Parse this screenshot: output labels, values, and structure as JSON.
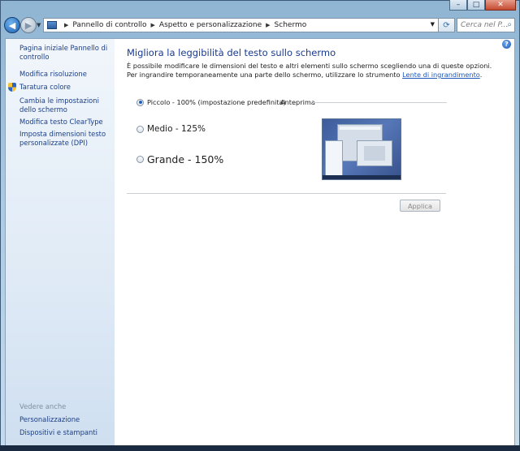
{
  "window": {
    "caption": {
      "minimize": "–",
      "maximize": "□",
      "close": "✕"
    }
  },
  "nav": {
    "back_glyph": "◀",
    "forward_glyph": "▶",
    "breadcrumb": [
      "Pannello di controllo",
      "Aspetto e personalizzazione",
      "Schermo"
    ],
    "search_placeholder": "Cerca nel P...",
    "icons": [
      "back-arrow-icon",
      "forward-arrow-icon",
      "control-panel-icon",
      "refresh-icon",
      "search-icon"
    ]
  },
  "sidebar": {
    "home": "Pagina iniziale Pannello di controllo",
    "items": [
      {
        "label": "Modifica risoluzione"
      },
      {
        "label": "Taratura colore",
        "icon": "shield-icon"
      },
      {
        "label": "Cambia le impostazioni dello schermo"
      },
      {
        "label": "Modifica testo ClearType"
      },
      {
        "label": "Imposta dimensioni testo personalizzate (DPI)"
      }
    ],
    "see_also_heading": "Vedere anche",
    "see_also": [
      "Personalizzazione",
      "Dispositivi e stampanti"
    ]
  },
  "main": {
    "title": "Migliora la leggibilità del testo sullo schermo",
    "desc_line1": "È possibile modificare le dimensioni del testo e altri elementi sullo schermo scegliendo una di queste opzioni.",
    "desc_line2_prefix": "Per ingrandire temporaneamente una parte dello schermo, utilizzare lo strumento ",
    "desc_link": "Lente di ingrandimento",
    "desc_suffix": ".",
    "options": [
      {
        "label": "Piccolo - 100% (impostazione predefinita)",
        "selected": true
      },
      {
        "label": "Medio - 125%",
        "selected": false
      },
      {
        "label": "Grande - 150%",
        "selected": false
      }
    ],
    "preview_label": "Anteprima",
    "apply_button": "Applica",
    "apply_enabled": false,
    "help_glyph": "?"
  }
}
